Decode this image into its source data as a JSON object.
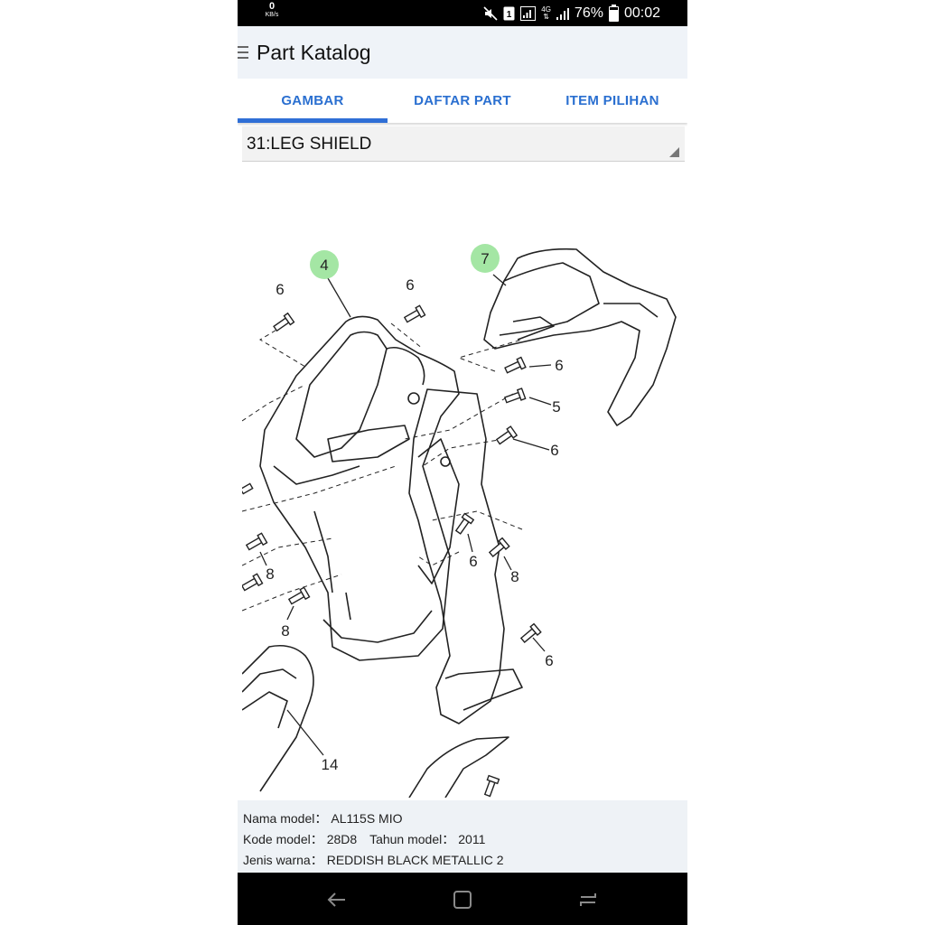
{
  "status_bar": {
    "data_speed": "0",
    "data_unit": "KB/s",
    "network": "4G",
    "battery": "76%",
    "time": "00:02"
  },
  "app_bar": {
    "title": "Part Katalog"
  },
  "tabs": [
    {
      "label": "GAMBAR",
      "active": true
    },
    {
      "label": "DAFTAR PART",
      "active": false
    },
    {
      "label": "ITEM PILIHAN",
      "active": false
    }
  ],
  "group_selector": {
    "value": "31:LEG SHIELD"
  },
  "diagram": {
    "callouts": [
      {
        "label": "4",
        "highlighted": true
      },
      {
        "label": "7",
        "highlighted": true
      },
      {
        "label": "6"
      },
      {
        "label": "5"
      },
      {
        "label": "8"
      },
      {
        "label": "14"
      }
    ]
  },
  "info": {
    "model_name_label": "Nama model：",
    "model_name": "AL115S MIO",
    "model_code_label": "Kode model：",
    "model_code": "28D8",
    "model_year_label": "Tahun model：",
    "model_year": "2011",
    "color_label": "Jenis warna：",
    "color": "REDDISH BLACK METALLIC 2"
  },
  "colors": {
    "accent": "#2f6fd6",
    "highlight_bubble": "#9fe59f"
  }
}
